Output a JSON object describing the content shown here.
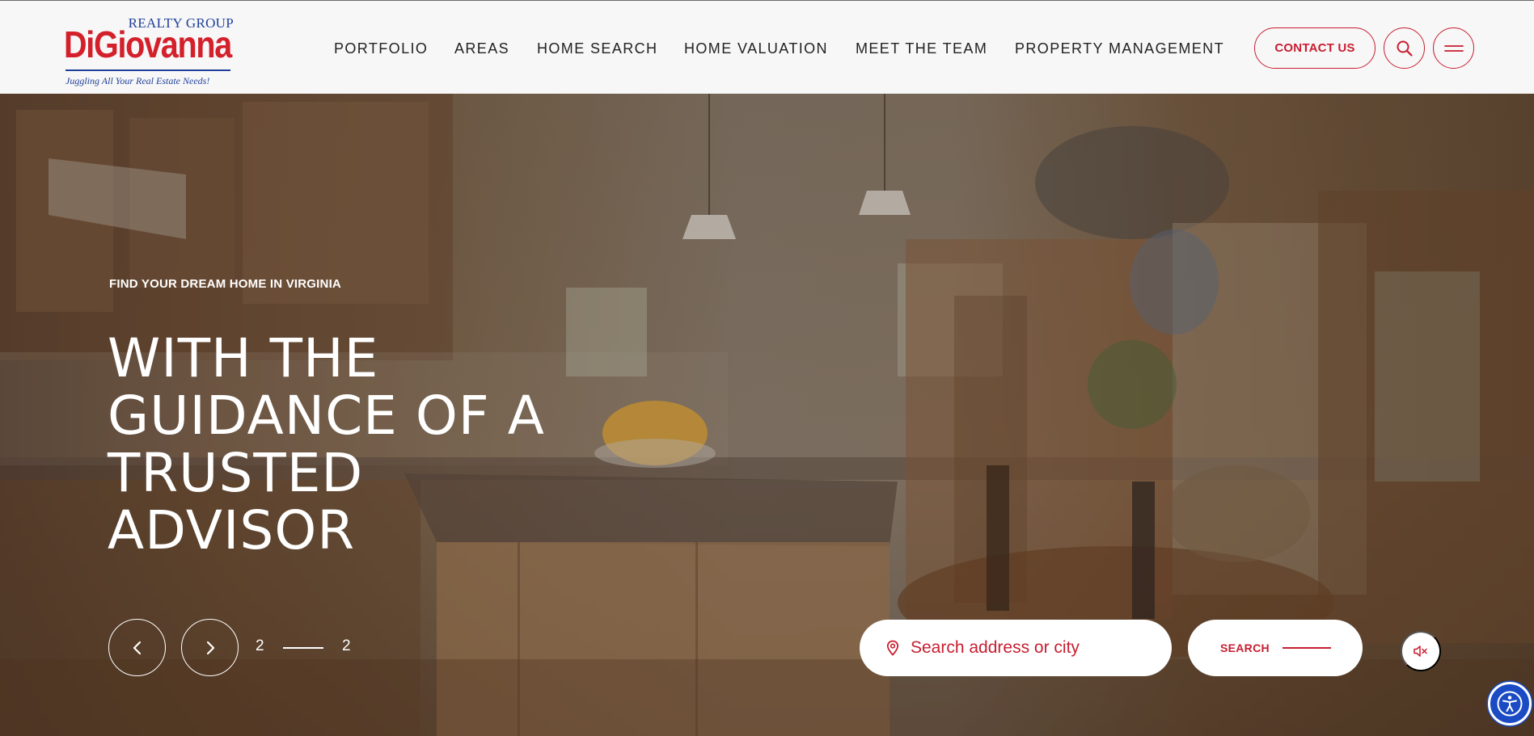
{
  "brand": {
    "group": "REALTY GROUP",
    "name": "DiGiovanna",
    "tagline": "Juggling All Your Real Estate Needs!",
    "primary_color": "#c81e30",
    "logo_blue": "#1f3f9a"
  },
  "nav": {
    "items": [
      {
        "label": "PORTFOLIO"
      },
      {
        "label": "AREAS"
      },
      {
        "label": "HOME SEARCH"
      },
      {
        "label": "HOME VALUATION"
      },
      {
        "label": "MEET THE TEAM"
      },
      {
        "label": "PROPERTY MANAGEMENT"
      }
    ],
    "contact_label": "CONTACT US",
    "search_icon": "search-icon",
    "menu_icon": "hamburger-menu-icon"
  },
  "hero": {
    "eyebrow": "FIND YOUR DREAM HOME IN VIRGINIA",
    "headline_lines": [
      "WITH THE",
      "GUIDANCE OF A",
      "TRUSTED",
      "ADVISOR"
    ],
    "slider": {
      "current": "2",
      "total": "2",
      "prev_icon": "chevron-left-icon",
      "next_icon": "chevron-right-icon"
    },
    "search": {
      "placeholder": "Search address or city",
      "value": "",
      "button_label": "SEARCH",
      "icon": "location-pin-icon"
    },
    "mute_icon": "speaker-muted-icon",
    "accessibility_icon": "accessibility-icon"
  }
}
